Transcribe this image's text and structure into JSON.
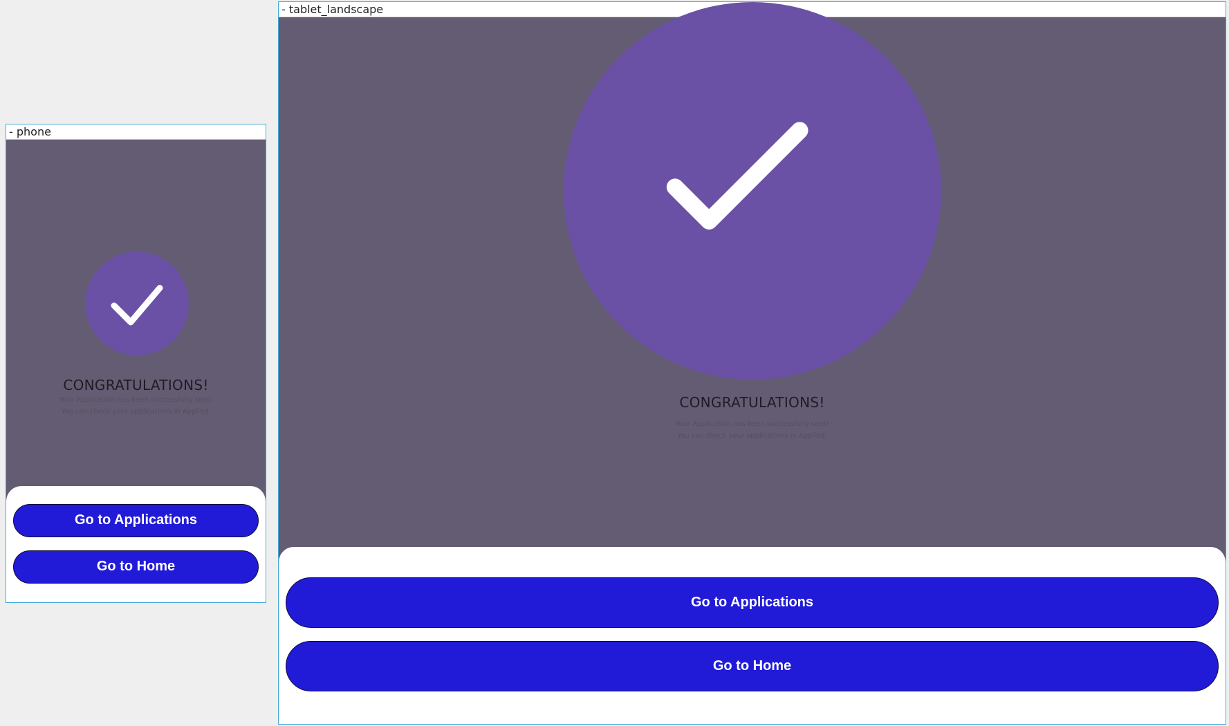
{
  "phone": {
    "label": "- phone",
    "title": "CONGRATULATIONS!",
    "description_line1": "Your Application has been successfully sent!",
    "description_line2": "You can check your applications in Applied.",
    "primary_button": "Go to Applications",
    "secondary_button": "Go to Home"
  },
  "tablet": {
    "label": "- tablet_landscape",
    "title": "CONGRATULATIONS!",
    "description_line1": "Your Application has been successfully sent!",
    "description_line2": "You can check your applications in Applied.",
    "primary_button": "Go to Applications",
    "secondary_button": "Go to Home"
  },
  "icons": {
    "success": "checkmark-icon"
  },
  "colors": {
    "overlay": "#645c73",
    "circle": "#6a51a6",
    "button": "#211bd8",
    "frame_border": "#3fa9d8"
  }
}
